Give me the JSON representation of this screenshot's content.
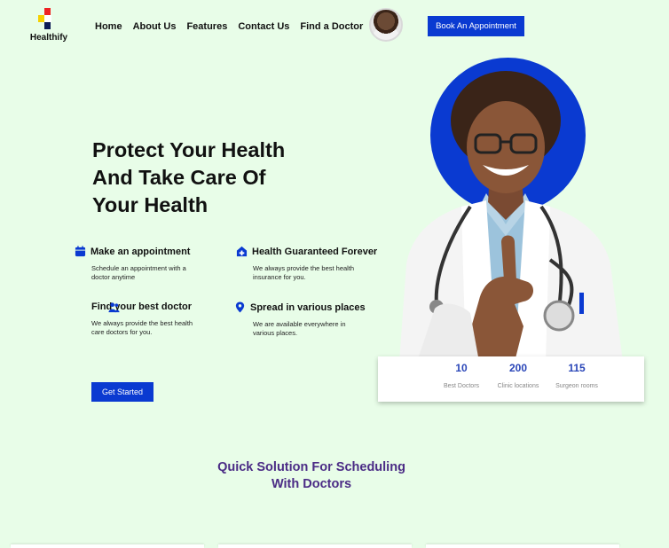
{
  "brand": {
    "name": "Healthify"
  },
  "nav": {
    "items": [
      "Home",
      "About Us",
      "Features",
      "Contact Us",
      "Find a Doctor"
    ]
  },
  "header": {
    "book_label": "Book An Appointment"
  },
  "hero": {
    "title_lines": [
      "Protect Your Health",
      "And Take Care Of",
      "Your Health"
    ],
    "cta_label": "Get Started"
  },
  "features": [
    {
      "title": "Make an appointment",
      "desc": "Schedule an appointment with a doctor anytime",
      "icon": "calendar-icon"
    },
    {
      "title": "Health Guaranteed Forever",
      "desc": "We always provide the best health insurance for you.",
      "icon": "medical-home-icon"
    },
    {
      "title": "Find your best doctor",
      "desc": "We always provide the best health care doctors for you.",
      "icon": "users-icon"
    },
    {
      "title": "Spread in various places",
      "desc": "We are available everywhere in various places.",
      "icon": "location-pin-icon"
    }
  ],
  "stats": [
    {
      "value": "10",
      "label": "Best Doctors"
    },
    {
      "value": "200",
      "label": "Clinic locations"
    },
    {
      "value": "115",
      "label": "Surgeon rooms"
    }
  ],
  "section": {
    "title_lines": [
      "Quick Solution For Scheduling",
      "With Doctors"
    ]
  },
  "colors": {
    "accent": "#0a3ad1",
    "background": "#e8fde8",
    "section_title": "#4a2b85"
  }
}
